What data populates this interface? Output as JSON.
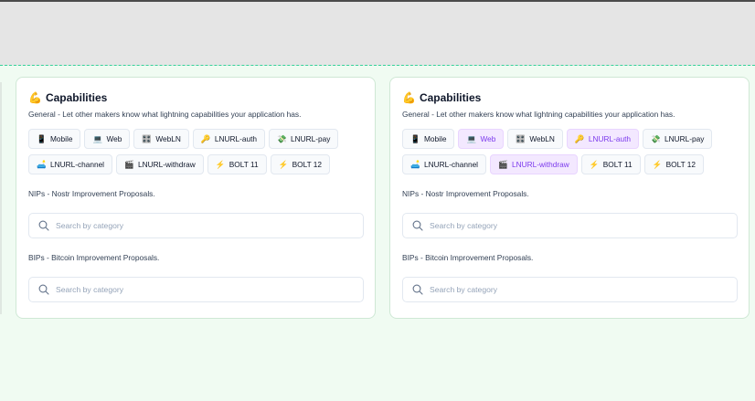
{
  "cards": [
    {
      "title_emoji": "💪",
      "title": "Capabilities",
      "description": "General - Let other makers know what lightning capabilities your application has.",
      "chips": [
        {
          "icon": "📱",
          "icon_name": "mobile-icon",
          "label": "Mobile",
          "selected": false
        },
        {
          "icon": "💻",
          "icon_name": "laptop-icon",
          "label": "Web",
          "selected": false
        },
        {
          "icon": "🎛️",
          "icon_name": "control-knobs-icon",
          "label": "WebLN",
          "selected": false
        },
        {
          "icon": "🔑",
          "icon_name": "key-icon",
          "label": "LNURL-auth",
          "selected": false
        },
        {
          "icon": "💸",
          "icon_name": "money-wings-icon",
          "label": "LNURL-pay",
          "selected": false
        },
        {
          "icon": "🛋️",
          "icon_name": "couch-icon",
          "label": "LNURL-channel",
          "selected": false
        },
        {
          "icon": "🎬",
          "icon_name": "clapper-icon",
          "label": "LNURL-withdraw",
          "selected": false
        },
        {
          "icon": "⚡",
          "icon_name": "lightning-icon",
          "label": "BOLT 11",
          "selected": false
        },
        {
          "icon": "⚡",
          "icon_name": "lightning-icon",
          "label": "BOLT 12",
          "selected": false
        }
      ],
      "nips": {
        "label": "NIPs - Nostr Improvement Proposals.",
        "placeholder": "Search by category"
      },
      "bips": {
        "label": "BIPs - Bitcoin Improvement Proposals.",
        "placeholder": "Search by category"
      }
    },
    {
      "title_emoji": "💪",
      "title": "Capabilities",
      "description": "General - Let other makers know what lightning capabilities your application has.",
      "chips": [
        {
          "icon": "📱",
          "icon_name": "mobile-icon",
          "label": "Mobile",
          "selected": false
        },
        {
          "icon": "💻",
          "icon_name": "laptop-icon",
          "label": "Web",
          "selected": true
        },
        {
          "icon": "🎛️",
          "icon_name": "control-knobs-icon",
          "label": "WebLN",
          "selected": false
        },
        {
          "icon": "🔑",
          "icon_name": "key-icon",
          "label": "LNURL-auth",
          "selected": true
        },
        {
          "icon": "💸",
          "icon_name": "money-wings-icon",
          "label": "LNURL-pay",
          "selected": false
        },
        {
          "icon": "🛋️",
          "icon_name": "couch-icon",
          "label": "LNURL-channel",
          "selected": false
        },
        {
          "icon": "🎬",
          "icon_name": "clapper-icon",
          "label": "LNURL-withdraw",
          "selected": true
        },
        {
          "icon": "⚡",
          "icon_name": "lightning-icon",
          "label": "BOLT 11",
          "selected": false
        },
        {
          "icon": "⚡",
          "icon_name": "lightning-icon",
          "label": "BOLT 12",
          "selected": false
        }
      ],
      "nips": {
        "label": "NIPs - Nostr Improvement Proposals.",
        "placeholder": "Search by category"
      },
      "bips": {
        "label": "BIPs - Bitcoin Improvement Proposals.",
        "placeholder": "Search by category"
      }
    }
  ],
  "colors": {
    "page_bg": "#f0fbf2",
    "topbar_bg": "#e5e5e5",
    "dash_accent": "#34d399",
    "selected_bg": "#f3e8ff",
    "selected_text": "#7c3aed"
  }
}
